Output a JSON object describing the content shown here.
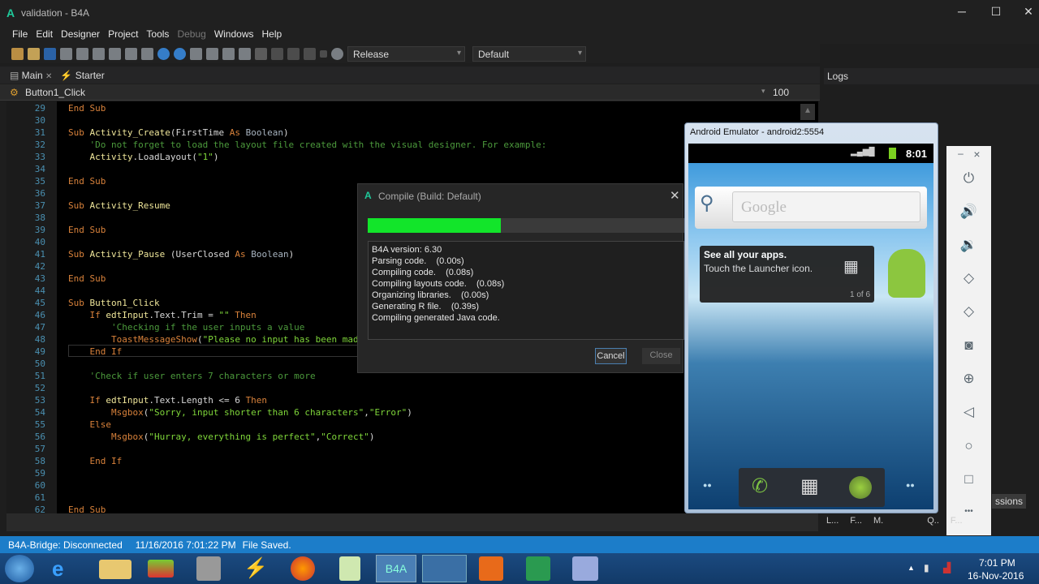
{
  "window": {
    "title": "validation - B4A",
    "logo": "A",
    "minimize": "─",
    "maximize": "☐",
    "close": "✕"
  },
  "menu": [
    "File",
    "Edit",
    "Designer",
    "Project",
    "Tools",
    "Debug",
    "Windows",
    "Help"
  ],
  "toolbar": {
    "build_config": "Release",
    "device": "Default"
  },
  "tabs": [
    {
      "label": "Main",
      "close": "✕"
    },
    {
      "label": "Starter"
    }
  ],
  "subbar": {
    "sub": "Button1_Click",
    "zoom": "100"
  },
  "logs_panel": {
    "title": "Logs"
  },
  "code": [
    {
      "n": "29",
      "t": [
        [
          "kw",
          "End Sub"
        ]
      ]
    },
    {
      "n": "30",
      "t": []
    },
    {
      "n": "31",
      "t": [
        [
          "kw",
          "Sub "
        ],
        [
          "id",
          "Activity_Create"
        ],
        [
          "tx",
          "(FirstTime "
        ],
        [
          "kw",
          "As "
        ],
        [
          "ty",
          "Boolean"
        ],
        [
          "tx",
          ")"
        ]
      ]
    },
    {
      "n": "32",
      "t": [
        [
          "cm",
          "    'Do not forget to load the layout file created with the visual designer. For example:"
        ]
      ]
    },
    {
      "n": "33",
      "t": [
        [
          "id",
          "    Activity"
        ],
        [
          "tx",
          ".LoadLayout("
        ],
        [
          "st",
          "\"1\""
        ],
        [
          "tx",
          ")"
        ]
      ]
    },
    {
      "n": "34",
      "t": []
    },
    {
      "n": "35",
      "t": [
        [
          "kw",
          "End Sub"
        ]
      ]
    },
    {
      "n": "36",
      "t": []
    },
    {
      "n": "37",
      "t": [
        [
          "kw",
          "Sub "
        ],
        [
          "id",
          "Activity_Resume"
        ]
      ]
    },
    {
      "n": "38",
      "t": []
    },
    {
      "n": "39",
      "t": [
        [
          "kw",
          "End Sub"
        ]
      ]
    },
    {
      "n": "40",
      "t": []
    },
    {
      "n": "41",
      "t": [
        [
          "kw",
          "Sub "
        ],
        [
          "id",
          "Activity_Pause "
        ],
        [
          "tx",
          "(UserClosed "
        ],
        [
          "kw",
          "As "
        ],
        [
          "ty",
          "Boolean"
        ],
        [
          "tx",
          ")"
        ]
      ]
    },
    {
      "n": "42",
      "t": []
    },
    {
      "n": "43",
      "t": [
        [
          "kw",
          "End Sub"
        ]
      ]
    },
    {
      "n": "44",
      "t": []
    },
    {
      "n": "45",
      "t": [
        [
          "kw",
          "Sub "
        ],
        [
          "id",
          "Button1_Click"
        ]
      ]
    },
    {
      "n": "46",
      "t": [
        [
          "kw",
          "    If "
        ],
        [
          "id",
          "edtInput"
        ],
        [
          "tx",
          ".Text.Trim = "
        ],
        [
          "st",
          "\"\""
        ],
        [
          "kw",
          " Then"
        ]
      ]
    },
    {
      "n": "47",
      "t": [
        [
          "cm",
          "        'Checking if the user inputs a value"
        ]
      ]
    },
    {
      "n": "48",
      "t": [
        [
          "kw",
          "        ToastMessageShow"
        ],
        [
          "tx",
          "("
        ],
        [
          "st",
          "\"Please no input has been mad"
        ]
      ]
    },
    {
      "n": "49",
      "t": [
        [
          "kw",
          "    End If"
        ]
      ]
    },
    {
      "n": "50",
      "t": []
    },
    {
      "n": "51",
      "t": [
        [
          "cm",
          "    'Check if user enters 7 characters or more"
        ]
      ]
    },
    {
      "n": "52",
      "t": []
    },
    {
      "n": "53",
      "t": [
        [
          "kw",
          "    If "
        ],
        [
          "id",
          "edtInput"
        ],
        [
          "tx",
          ".Text.Length <= 6 "
        ],
        [
          "kw",
          "Then"
        ]
      ]
    },
    {
      "n": "54",
      "t": [
        [
          "kw",
          "        Msgbox"
        ],
        [
          "tx",
          "("
        ],
        [
          "st",
          "\"Sorry, input shorter than 6 characters\""
        ],
        [
          "tx",
          ","
        ],
        [
          "st",
          "\"Error\""
        ],
        [
          "tx",
          ")"
        ]
      ]
    },
    {
      "n": "55",
      "t": [
        [
          "kw",
          "    Else"
        ]
      ]
    },
    {
      "n": "56",
      "t": [
        [
          "kw",
          "        Msgbox"
        ],
        [
          "tx",
          "("
        ],
        [
          "st",
          "\"Hurray, everything is perfect\""
        ],
        [
          "tx",
          ","
        ],
        [
          "st",
          "\"Correct\""
        ],
        [
          "tx",
          ")"
        ]
      ]
    },
    {
      "n": "57",
      "t": []
    },
    {
      "n": "58",
      "t": [
        [
          "kw",
          "    End If"
        ]
      ]
    },
    {
      "n": "59",
      "t": []
    },
    {
      "n": "60",
      "t": []
    },
    {
      "n": "61",
      "t": []
    },
    {
      "n": "62",
      "t": [
        [
          "kw",
          "End Sub"
        ]
      ]
    }
  ],
  "dialog": {
    "title": "Compile (Build: Default)",
    "progress_percent": 42,
    "log": [
      "B4A version: 6.30",
      "Parsing code.    (0.00s)",
      "Compiling code.    (0.08s)",
      "Compiling layouts code.    (0.08s)",
      "Organizing libraries.    (0.00s)",
      "Generating R file.    (0.39s)",
      "Compiling generated Java code."
    ],
    "cancel": "Cancel",
    "close": "Close"
  },
  "emulator": {
    "title": "Android Emulator - android2:5554",
    "time": "8:01",
    "search_placeholder": "Google",
    "tip_title": "See all your apps.",
    "tip_body": "Touch the Launcher icon.",
    "tip_page": "1 of 6"
  },
  "side_panel": {
    "min": "–",
    "close": "×",
    "more": "•••"
  },
  "bottom_tabs": [
    "L...",
    "F...",
    "M.",
    "Q..",
    "F..."
  ],
  "permissions_fragment": "ssions",
  "status": {
    "bridge": "B4A-Bridge: Disconnected",
    "time": "11/16/2016 7:01:22 PM",
    "message": "File Saved."
  },
  "taskbar": {
    "b4a_label": "B4A",
    "clock_time": "7:01 PM",
    "clock_date": "16-Nov-2016"
  },
  "colors": {
    "accent": "#1c7dc9",
    "progress": "#12e52a"
  }
}
